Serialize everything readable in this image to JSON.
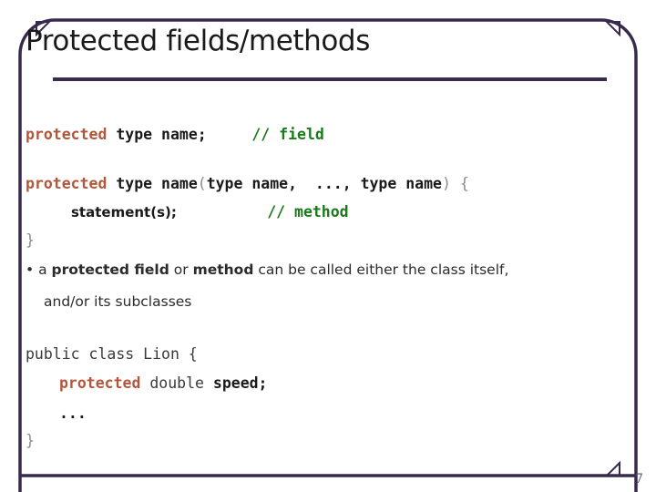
{
  "slide": {
    "title": "Protected fields/methods",
    "page_number": "7",
    "accent_color": "#382A4D",
    "keyword_color": "#B2563C",
    "comment_color": "#1A7A1A",
    "punct_color": "#8C8C8C"
  },
  "code_block_1": {
    "line1": {
      "keyword": "protected",
      "space1": " ",
      "decl": "type name;",
      "gap": "     ",
      "comment": "// field"
    },
    "line2": {
      "keyword": "protected",
      "space1": " ",
      "decl": "type name",
      "open_paren": "(",
      "params": "type name,  ..., type name",
      "close_paren": ")",
      "space2": " ",
      "open_brace": "{"
    },
    "line3": {
      "statement": "statement(s);",
      "comment": "// method"
    },
    "line4": {
      "close_brace": "}"
    }
  },
  "bullet": {
    "marker": "•",
    "seg1": " a ",
    "bold1": "protected field",
    "seg2": " or ",
    "bold2": "method",
    "seg3": " can be called either the class itself,",
    "continuation": "and/or its subclasses"
  },
  "code_block_2": {
    "line1": "public class Lion {",
    "line2": {
      "keyword": "protected",
      "space": " ",
      "type": "double",
      "space2": " ",
      "field": "speed;"
    },
    "line3": "...",
    "line4": "}"
  }
}
